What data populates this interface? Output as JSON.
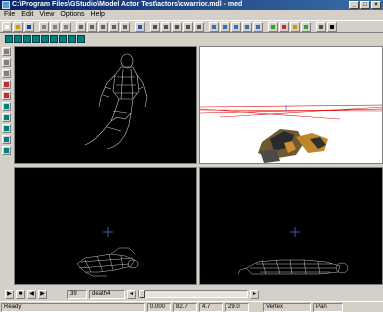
{
  "window": {
    "title": "C:\\Program Files\\GStudio\\Model Actor Test\\actors\\cwarrior.mdl - med",
    "minimize": "_",
    "maximize": "□",
    "close": "×"
  },
  "menu": [
    "File",
    "Edit",
    "View",
    "Options",
    "Help"
  ],
  "playbar": {
    "frame": "39",
    "animation": "death4",
    "slider_position": 0.0
  },
  "status": {
    "ready": "Ready",
    "x": "0.000",
    "y": "82.7",
    "z": "4.7",
    "w": "29.0",
    "mode": "Vertex",
    "tool": "Pan"
  },
  "colors": {
    "titlebar": "#0a246a",
    "wireframe": "#c8c8c8",
    "crosshair": "#4a6fd8",
    "ground_lines": "#e01010"
  }
}
